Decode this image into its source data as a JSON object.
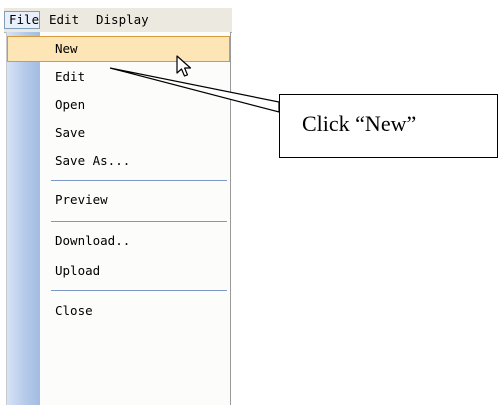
{
  "menubar": {
    "items": [
      {
        "label": "File",
        "active": true
      },
      {
        "label": "Edit",
        "active": false
      },
      {
        "label": "Display",
        "active": false
      }
    ]
  },
  "file_menu": {
    "items": [
      {
        "label": "New",
        "highlighted": true
      },
      {
        "label": "Edit"
      },
      {
        "label": "Open"
      },
      {
        "label": "Save"
      },
      {
        "label": "Save As..."
      },
      {
        "label": "Preview"
      },
      {
        "label": "Download.."
      },
      {
        "label": "Upload"
      },
      {
        "label": "Close"
      }
    ]
  },
  "callout": {
    "text": "Click “New”"
  },
  "colors": {
    "highlight_fill": "#fde5b5",
    "highlight_border": "#d59a3c",
    "separator": "#7c98c8",
    "gutter": "#b5caea"
  },
  "icons": {
    "pointer": "arrow-cursor-icon"
  }
}
